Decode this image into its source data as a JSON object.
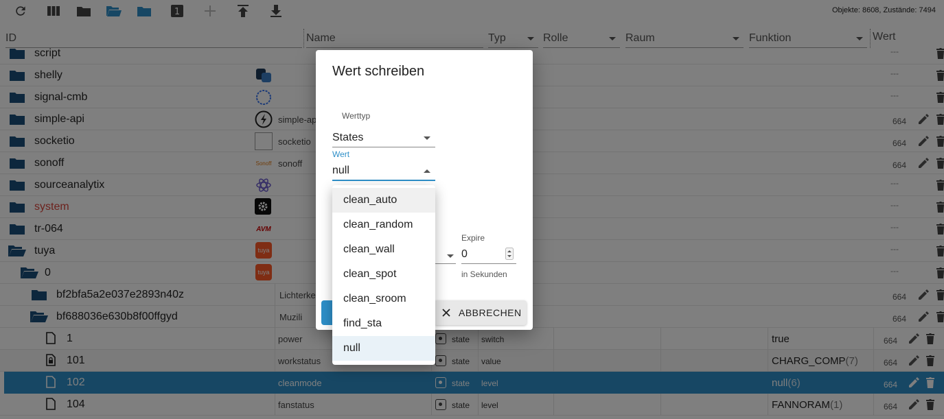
{
  "toolbar": {
    "icons": [
      "refresh-icon",
      "columns-icon",
      "folder-icon",
      "folder-open-icon",
      "folder-blue-icon",
      "number-one-icon",
      "add-icon",
      "upload-icon",
      "download-icon"
    ],
    "counts": "Objekte: 8608, Zustände: 7494"
  },
  "header": {
    "id": "ID",
    "name": "Name",
    "typ": "Typ",
    "rolle": "Rolle",
    "raum": "Raum",
    "funktion": "Funktion",
    "wert": "Wert"
  },
  "rows": [
    {
      "label": "script",
      "name": "",
      "dash": "---"
    },
    {
      "label": "shelly",
      "name": "",
      "dash": "---"
    },
    {
      "label": "signal-cmb",
      "name": "",
      "dash": "---"
    },
    {
      "label": "simple-api",
      "name": "simple-api",
      "num": "664"
    },
    {
      "label": "socketio",
      "name": "socketio",
      "num": "664"
    },
    {
      "label": "sonoff",
      "name": "sonoff",
      "num": "664",
      "logo": "Sonoff"
    },
    {
      "label": "sourceanalytix",
      "name": "",
      "dash": "---"
    },
    {
      "label": "system",
      "name": "",
      "dash": "---"
    },
    {
      "label": "tr-064",
      "name": "",
      "dash": "---",
      "logo": "AVM"
    },
    {
      "label": "tuya",
      "name": "",
      "dash": "---",
      "logo": "tuya"
    },
    {
      "label": "0",
      "name": "",
      "dash": "---",
      "logo": "tuya"
    },
    {
      "label": "bf2bfa5a2e037e2893n40z",
      "name": "Lichterke",
      "num": "664"
    },
    {
      "label": "bf688036e630b8f00ffgyd",
      "name": "Muzili",
      "num": "664"
    },
    {
      "label": "1",
      "name": "power",
      "typ": "state",
      "rolle": "switch",
      "value": "true",
      "num": "664"
    },
    {
      "label": "101",
      "name": "workstatus",
      "typ": "state",
      "rolle": "value",
      "value": "CHARG_COMP",
      "ack": "(7)",
      "num": "664"
    },
    {
      "label": "102",
      "name": "cleanmode",
      "typ": "state",
      "rolle": "level",
      "value": "null",
      "ack": "(6)",
      "num": "664"
    },
    {
      "label": "104",
      "name": "fanstatus",
      "typ": "state",
      "rolle": "level",
      "value": "FANNORAM",
      "ack": "(1)",
      "num": "664"
    }
  ],
  "dialog": {
    "title": "Wert schreiben",
    "werttyp_label": "Werttyp",
    "werttyp_value": "States",
    "wert_label": "Wert",
    "wert_value": "null",
    "expire_label": "Expire",
    "expire_value": "0",
    "expire_helper": "in Sekunden",
    "cancel_label": "ABBRECHEN"
  },
  "menu": {
    "options": [
      "clean_auto",
      "clean_random",
      "clean_wall",
      "clean_spot",
      "clean_sroom",
      "find_sta",
      "null"
    ],
    "selected": "null"
  },
  "colors": {
    "accent": "#2e8fc8",
    "folder": "#1a4f7a",
    "system_red": "#d9443a"
  }
}
